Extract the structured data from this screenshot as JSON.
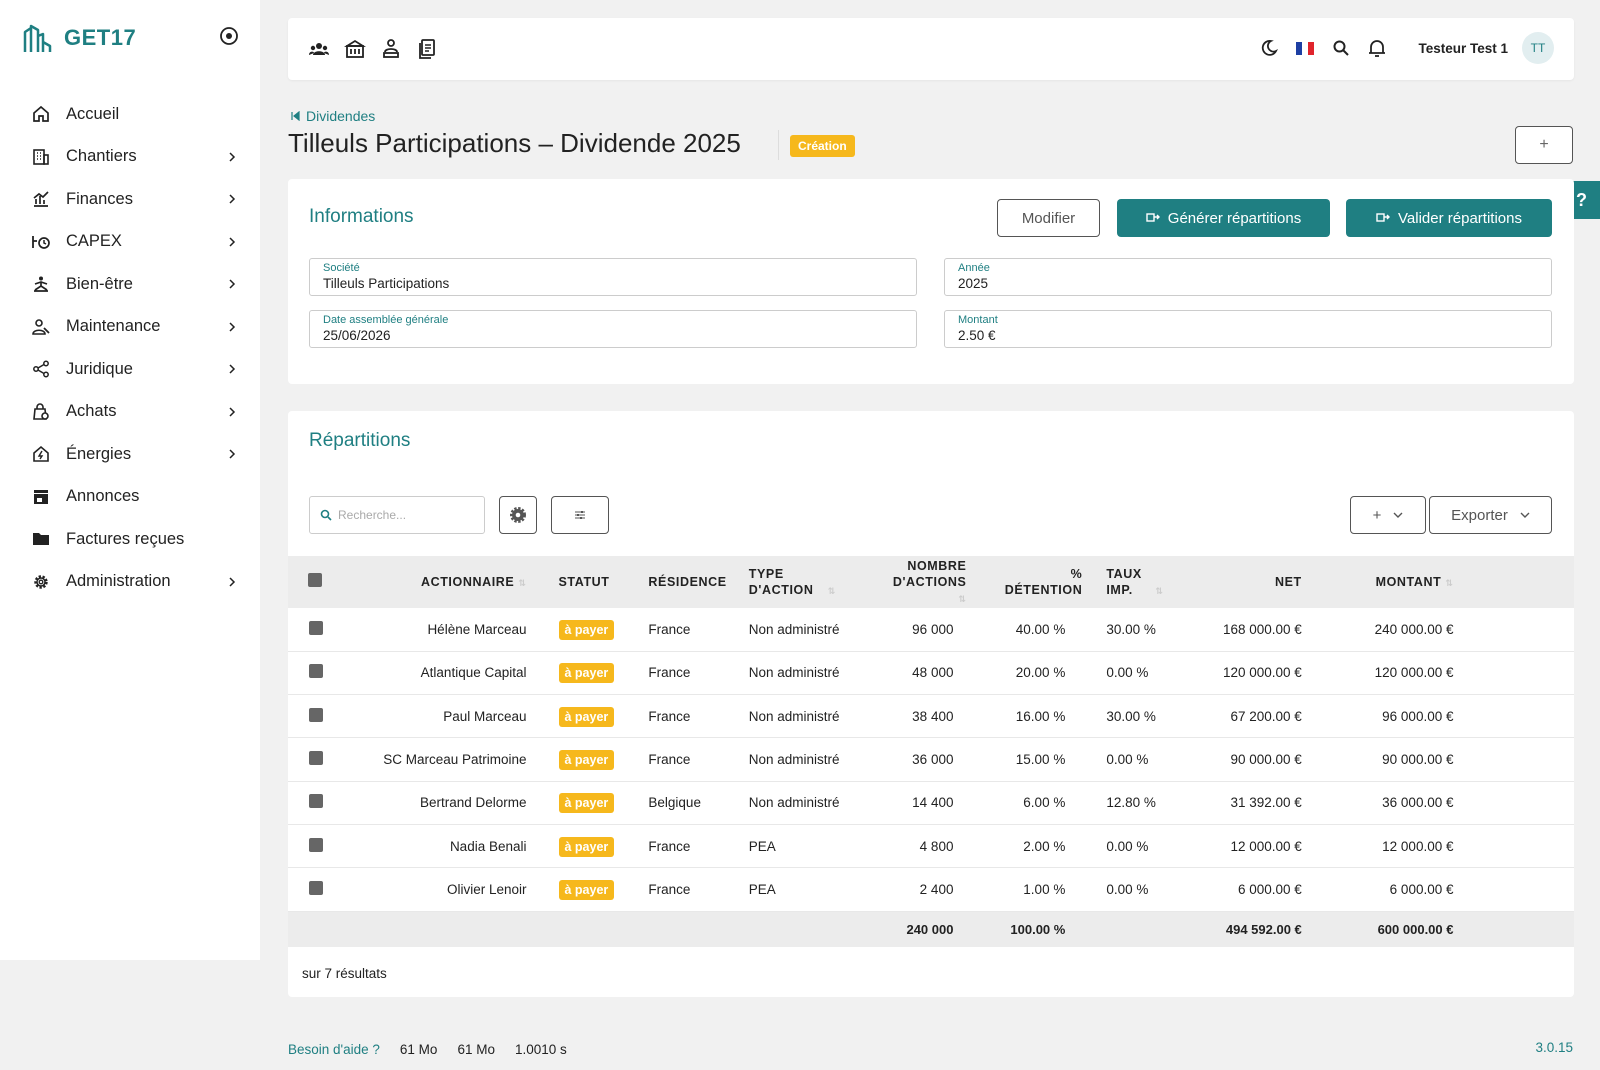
{
  "app": {
    "name": "GET17",
    "accent": "#1f7f82",
    "warning": "#f6b81c"
  },
  "sidebar": {
    "items": [
      {
        "label": "Accueil",
        "icon": "home-icon",
        "chevron": false
      },
      {
        "label": "Chantiers",
        "icon": "building-icon",
        "chevron": true
      },
      {
        "label": "Finances",
        "icon": "finance-chart-icon",
        "chevron": true
      },
      {
        "label": "CAPEX",
        "icon": "capex-icon",
        "chevron": true
      },
      {
        "label": "Bien-être",
        "icon": "wellbeing-icon",
        "chevron": true
      },
      {
        "label": "Maintenance",
        "icon": "maintenance-icon",
        "chevron": true
      },
      {
        "label": "Juridique",
        "icon": "share-icon",
        "chevron": true
      },
      {
        "label": "Achats",
        "icon": "shopping-bag-icon",
        "chevron": true
      },
      {
        "label": "Énergies",
        "icon": "energy-home-icon",
        "chevron": true
      },
      {
        "label": "Annonces",
        "icon": "store-icon",
        "chevron": false
      },
      {
        "label": "Factures reçues",
        "icon": "folder-icon",
        "chevron": false
      },
      {
        "label": "Administration",
        "icon": "gear-icon",
        "chevron": true
      }
    ]
  },
  "topbar": {
    "user_name": "Testeur Test 1",
    "avatar_initials": "TT"
  },
  "header": {
    "breadcrumb": "Dividendes",
    "title": "Tilleuls Participations – Dividende 2025",
    "status": "Création",
    "add_button": "+"
  },
  "help": {
    "label": "?"
  },
  "informations": {
    "title": "Informations",
    "modify_button": "Modifier",
    "generate_button": "Générer répartitions",
    "validate_button": "Valider répartitions",
    "fields": {
      "societe": {
        "label": "Société",
        "value": "Tilleuls Participations"
      },
      "annee": {
        "label": "Année",
        "value": "2025"
      },
      "date_ag": {
        "label": "Date assemblée générale",
        "value": "25/06/2026"
      },
      "montant": {
        "label": "Montant",
        "value": "2.50 €"
      }
    }
  },
  "repartitions": {
    "title": "Répartitions",
    "search_placeholder": "Recherche...",
    "add_button": "+",
    "export_button": "Exporter",
    "columns": [
      "Actionnaire",
      "Statut",
      "Résidence",
      "Type d'action",
      "Nombre d'actions",
      "% Détention",
      "Taux imp.",
      "Net",
      "Montant"
    ],
    "rows": [
      {
        "actionnaire": "Hélène Marceau",
        "statut": "à payer",
        "residence": "France",
        "type": "Non administré",
        "nombre": "96 000",
        "detention": "40.00 %",
        "taux": "30.00 %",
        "net": "168 000.00 €",
        "montant": "240 000.00 €"
      },
      {
        "actionnaire": "Atlantique Capital",
        "statut": "à payer",
        "residence": "France",
        "type": "Non administré",
        "nombre": "48 000",
        "detention": "20.00 %",
        "taux": "0.00 %",
        "net": "120 000.00 €",
        "montant": "120 000.00 €"
      },
      {
        "actionnaire": "Paul Marceau",
        "statut": "à payer",
        "residence": "France",
        "type": "Non administré",
        "nombre": "38 400",
        "detention": "16.00 %",
        "taux": "30.00 %",
        "net": "67 200.00 €",
        "montant": "96 000.00 €"
      },
      {
        "actionnaire": "SC Marceau Patrimoine",
        "statut": "à payer",
        "residence": "France",
        "type": "Non administré",
        "nombre": "36 000",
        "detention": "15.00 %",
        "taux": "0.00 %",
        "net": "90 000.00 €",
        "montant": "90 000.00 €"
      },
      {
        "actionnaire": "Bertrand Delorme",
        "statut": "à payer",
        "residence": "Belgique",
        "type": "Non administré",
        "nombre": "14 400",
        "detention": "6.00 %",
        "taux": "12.80 %",
        "net": "31 392.00 €",
        "montant": "36 000.00 €"
      },
      {
        "actionnaire": "Nadia Benali",
        "statut": "à payer",
        "residence": "France",
        "type": "PEA",
        "nombre": "4 800",
        "detention": "2.00 %",
        "taux": "0.00 %",
        "net": "12 000.00 €",
        "montant": "12 000.00 €"
      },
      {
        "actionnaire": "Olivier Lenoir",
        "statut": "à payer",
        "residence": "France",
        "type": "PEA",
        "nombre": "2 400",
        "detention": "1.00 %",
        "taux": "0.00 %",
        "net": "6 000.00 €",
        "montant": "6 000.00 €"
      }
    ],
    "totals": {
      "nombre": "240 000",
      "detention": "100.00 %",
      "net": "494 592.00 €",
      "montant": "600 000.00 €"
    },
    "results": "sur 7 résultats"
  },
  "footer": {
    "help_link": "Besoin d'aide ?",
    "mem1": "61 Mo",
    "mem2": "61 Mo",
    "time": "1.0010 s",
    "version": "3.0.15"
  }
}
